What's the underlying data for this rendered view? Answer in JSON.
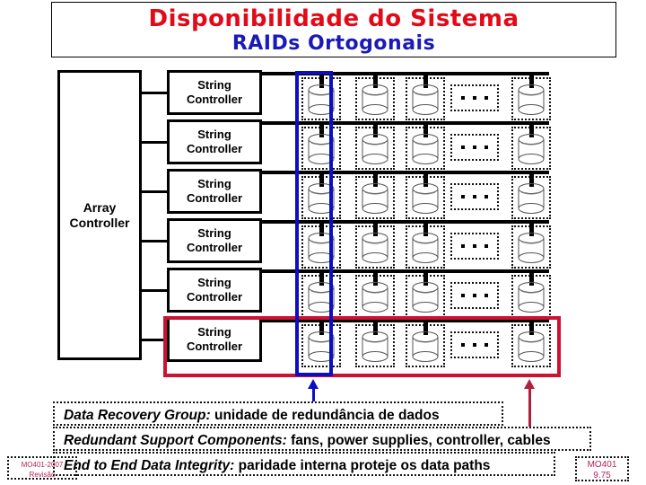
{
  "title": {
    "main": "Disponibilidade do Sistema",
    "subtitle": "RAIDs Ortogonais",
    "main_color": "#e30a17",
    "subtitle_color": "#1a1ab8"
  },
  "diagram": {
    "array_controller": {
      "line1": "Array",
      "line2": "Controller"
    },
    "string_controller": {
      "line1": "String",
      "line2": "Controller"
    },
    "row_count": 6,
    "disks_per_row": 4,
    "ellipsis_glyph": "...",
    "highlights": {
      "blue_rect_label": "Data Recovery Group column",
      "blue_color": "#0d0dc4",
      "red_rect_label": "Redundant Support Components row",
      "red_color": "#cc1133"
    }
  },
  "captions": [
    {
      "term": "Data Recovery Group:",
      "text": " unidade de redundância de dados"
    },
    {
      "term": "Redundant Support Components:",
      "text": " fans, power supplies, controller, cables"
    },
    {
      "term": "End to End Data Integrity:",
      "text": " paridade interna proteje os data paths"
    }
  ],
  "corners": {
    "left_line1": "MO401-2007",
    "left_line2": "Revisão",
    "right_line1": "MO401",
    "right_line2": "9.75"
  }
}
